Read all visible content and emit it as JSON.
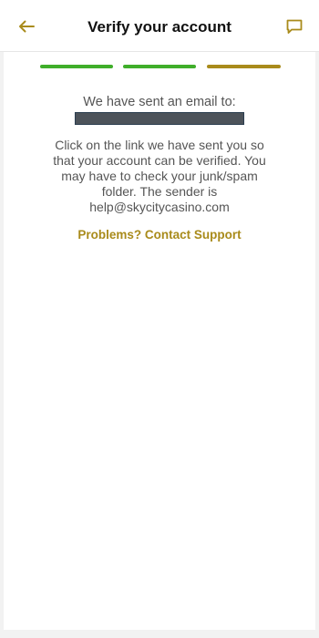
{
  "header": {
    "title": "Verify your account",
    "back_icon": "arrow-left-icon",
    "chat_icon": "chat-bubble-icon"
  },
  "progress": {
    "steps_total": 3,
    "colors": [
      "#3fae2a",
      "#3fae2a",
      "#a98b1b"
    ]
  },
  "content": {
    "sent_label": "We have sent an email to:",
    "email_value": "",
    "instructions": "Click on the link we have sent you so that your account can be verified. You may have to check your junk/spam folder. The sender is help@skycitycasino.com",
    "support_link": "Problems? Contact Support"
  },
  "colors": {
    "accent": "#a98b1b",
    "success": "#3fae2a",
    "title": "#111111",
    "body_text": "#555555",
    "background": "#f2f2f2"
  }
}
